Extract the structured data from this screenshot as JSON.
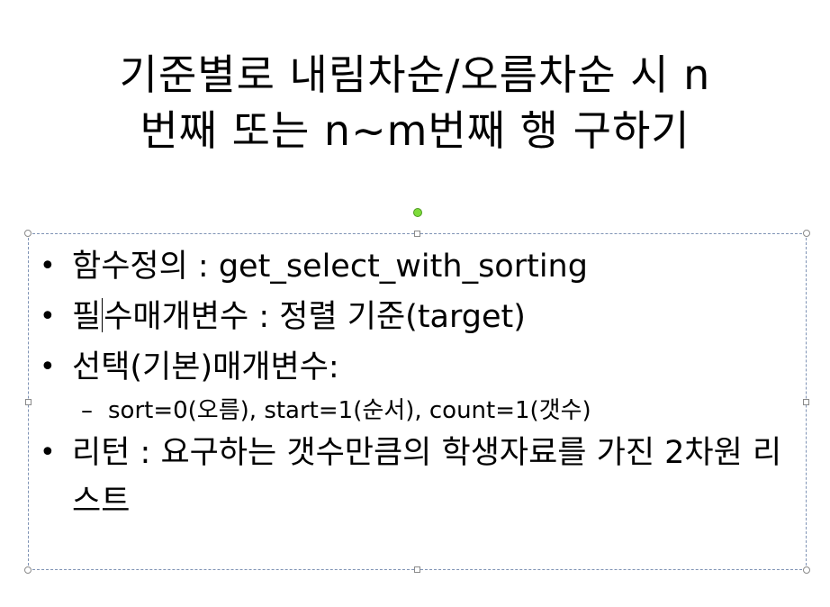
{
  "slide": {
    "title_line1": "기준별로 내림차순/오름차순 시 n",
    "title_line2": "번째 또는 n~m번째 행 구하기",
    "bullets": [
      {
        "text": "함수정의 : get_select_with_sorting"
      },
      {
        "text_before_caret": "필",
        "text_after_caret": "수매개변수 : 정렬 기준(target)"
      },
      {
        "text": "선택(기본)매개변수:"
      },
      {
        "sub_marker": "–",
        "sub_text": "sort=0(오름), start=1(순서), count=1(갯수)"
      },
      {
        "text": "리턴 : 요구하는 갯수만큼의 학생자료를 가진 2차원 리스트"
      }
    ],
    "bullet_marker": "•"
  },
  "colors": {
    "selection_border": "#7f93b5",
    "rotate_handle": "#7ddc3a"
  }
}
